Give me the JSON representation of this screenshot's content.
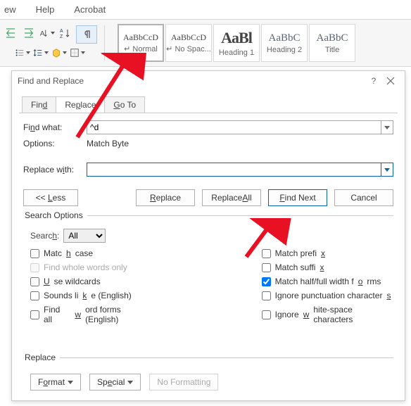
{
  "ribbon": {
    "tabs": [
      "ew",
      "Help",
      "Acrobat"
    ],
    "styles": [
      {
        "preview": "AaBbCcD",
        "label": "Normal",
        "size": "12px",
        "color": "#333"
      },
      {
        "preview": "AaBbCcD",
        "label": "No Spac...",
        "size": "12px",
        "color": "#333"
      },
      {
        "preview": "AaBl",
        "label": "Heading 1",
        "size": "22px",
        "color": "#222",
        "weight": "600"
      },
      {
        "preview": "AaBbC",
        "label": "Heading 2",
        "size": "15px",
        "color": "#5b6470"
      },
      {
        "preview": "AaBbC",
        "label": "Title",
        "size": "15px",
        "color": "#5b6470"
      }
    ]
  },
  "dialog": {
    "title": "Find and Replace",
    "tabs": {
      "find": "Find",
      "replace": "Replace",
      "goto": "Go To"
    },
    "find_label": "Find what:",
    "find_value": "^d",
    "options_label": "Options:",
    "options_value": "Match Byte",
    "replace_label": "Replace with:",
    "replace_value": "",
    "less_btn": "<< Less",
    "replace_btn": "Replace",
    "replace_all_btn": "Replace All",
    "find_next_btn": "Find Next",
    "cancel_btn": "Cancel",
    "search_options_legend": "Search Options",
    "search_label": "Search:",
    "search_sel": "All",
    "left": [
      {
        "label": "Match case",
        "checked": false,
        "disabled": false,
        "key": "c"
      },
      {
        "label": "Find whole words only",
        "checked": false,
        "disabled": true
      },
      {
        "label": "Use wildcards",
        "checked": false,
        "disabled": false,
        "key": "U"
      },
      {
        "label": "Sounds like (English)",
        "checked": false,
        "disabled": false,
        "key": "S"
      },
      {
        "label": "Find all word forms (English)",
        "checked": false,
        "disabled": false,
        "key": "w"
      }
    ],
    "right": [
      {
        "label": "Match prefix",
        "checked": false,
        "key": "p"
      },
      {
        "label": "Match suffix",
        "checked": false,
        "key": "s"
      },
      {
        "label": "Match half/full width forms",
        "checked": true,
        "key": "o"
      },
      {
        "label": "Ignore punctuation characters",
        "checked": false,
        "key": "s"
      },
      {
        "label": "Ignore white-space characters",
        "checked": false,
        "key": "w"
      }
    ],
    "replace_section": "Replace",
    "format_btn": "Format",
    "special_btn": "Special",
    "noformat_btn": "No Formatting"
  }
}
